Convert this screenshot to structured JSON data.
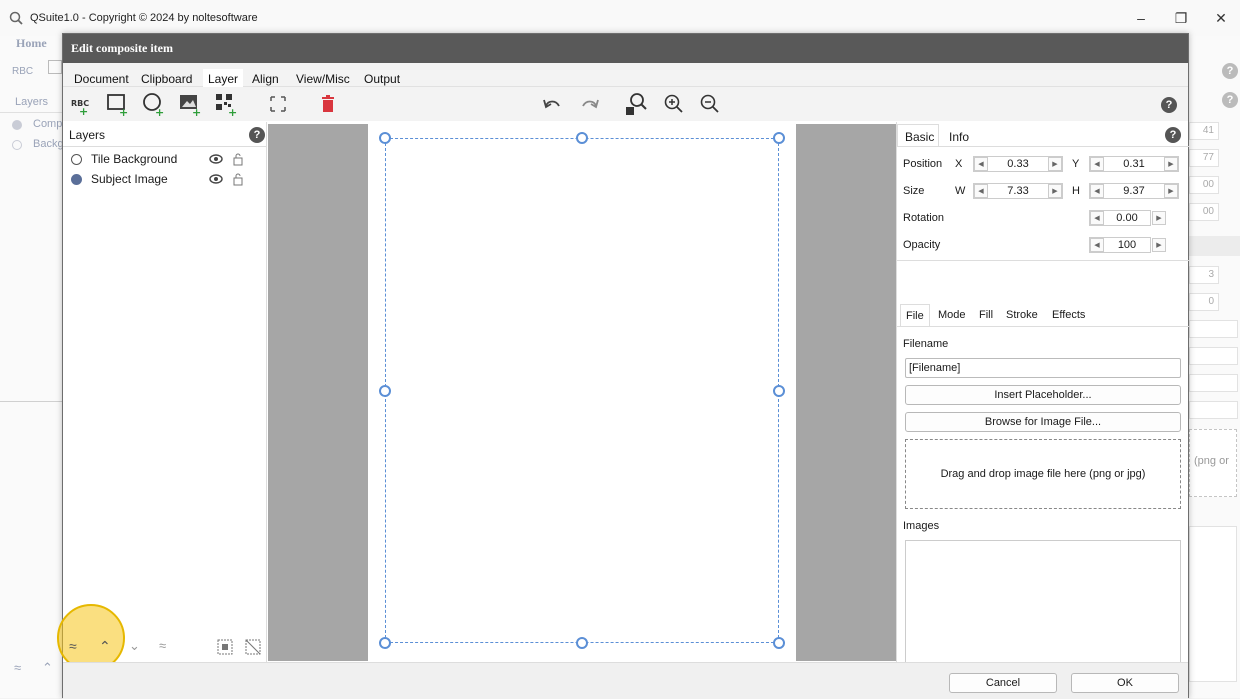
{
  "window": {
    "title": "QSuite1.0 - Copyright © 2024 by noltesoftware",
    "minimize": "–",
    "restore": "❐",
    "close": "✕"
  },
  "background_app": {
    "home": "Home",
    "layers": "Layers",
    "layer_items": [
      "Comp",
      "Backg"
    ],
    "fields": [
      "41",
      "77",
      "00",
      "00",
      "3",
      "0"
    ],
    "dropzone_partial": "(png or"
  },
  "dialog": {
    "title": "Edit composite item",
    "menu_tabs": [
      "Document",
      "Clipboard",
      "Layer",
      "Align",
      "View/Misc",
      "Output"
    ],
    "active_tab": "Layer",
    "toolbar_icons": [
      "add-text-icon",
      "add-rectangle-icon",
      "add-ellipse-icon",
      "add-image-icon",
      "add-qr-code-icon",
      "fit-to-page-icon",
      "delete-icon",
      "undo-icon",
      "redo-icon",
      "zoom-fit-icon",
      "zoom-in-icon",
      "zoom-out-icon",
      "help-icon"
    ]
  },
  "layers_panel": {
    "tab": "Layers",
    "help": "?",
    "items": [
      {
        "name": "Tile Background",
        "selected": false
      },
      {
        "name": "Subject Image",
        "selected": true
      }
    ]
  },
  "props": {
    "tabs": [
      "Basic",
      "Info"
    ],
    "active_tab": "Basic",
    "help": "?",
    "position_label": "Position",
    "x_label": "X",
    "x_value": "0.33",
    "y_label": "Y",
    "y_value": "0.31",
    "size_label": "Size",
    "w_label": "W",
    "w_value": "7.33",
    "h_label": "H",
    "h_value": "9.37",
    "rotation_label": "Rotation",
    "rotation_value": "0.00",
    "opacity_label": "Opacity",
    "opacity_value": "100",
    "subtabs": [
      "File",
      "Mode",
      "Fill",
      "Stroke",
      "Effects"
    ],
    "active_subtab": "File",
    "filename_label": "Filename",
    "filename_value": "[Filename]",
    "insert_placeholder": "Insert Placeholder...",
    "browse": "Browse for Image File...",
    "dropzone": "Drag and drop image file here (png or jpg)",
    "images_label": "Images"
  },
  "footer": {
    "cancel": "Cancel",
    "ok": "OK"
  },
  "colors": {
    "dialog_title_bg": "#595959",
    "selection": "#5b8fd6",
    "highlight": "#f5c518",
    "delete": "#d9363e"
  }
}
